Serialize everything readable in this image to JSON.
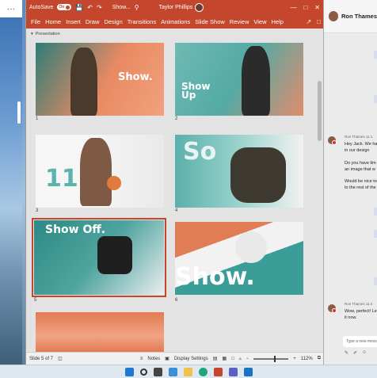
{
  "left_window": {
    "menu_icon": "ellipsis-icon",
    "menu_label": "···"
  },
  "powerpoint": {
    "autosave_label": "AutoSave",
    "autosave_state": "On",
    "doc_title": "Show...",
    "user_name": "Taylor Phillips",
    "tabs": [
      "File",
      "Home",
      "Insert",
      "Draw",
      "Design",
      "Transitions",
      "Animations",
      "Slide Show",
      "Review",
      "View",
      "Help"
    ],
    "section_label": "Presentation",
    "slides": [
      {
        "num": "1",
        "text": "Show."
      },
      {
        "num": "2",
        "text": "Show Up"
      },
      {
        "num": "3",
        "text": "11"
      },
      {
        "num": "4",
        "text": "So"
      },
      {
        "num": "5",
        "text": "Show Off."
      },
      {
        "num": "6",
        "text": "Show."
      },
      {
        "num": "7",
        "text": ""
      }
    ],
    "selected_slide": "5",
    "status": {
      "slide_info": "Slide 5 of 7",
      "notes_label": "Notes",
      "display_settings_label": "Display Settings",
      "zoom": "112%"
    },
    "accent_color": "#c4462c"
  },
  "teams": {
    "contact_name": "Ron Thames",
    "messages": [
      {
        "meta": "Ron Thames 11:1",
        "lines": [
          "Hey Jack. We ha",
          "in our design"
        ]
      },
      {
        "meta": "",
        "lines": [
          "Do you have tim",
          "an image that w"
        ]
      },
      {
        "meta": "",
        "lines": [
          "Would be nice to",
          "to the rest of the"
        ]
      },
      {
        "meta": "Ron Thames 11:4",
        "lines": [
          "Wow, perfect! Le",
          "it now."
        ]
      }
    ],
    "compose_placeholder": "Type a new mess"
  },
  "taskbar": {
    "icons": [
      "windows-start-icon",
      "search-icon",
      "task-view-icon",
      "widgets-icon",
      "file-explorer-icon",
      "edge-icon",
      "powerpoint-icon",
      "teams-icon",
      "mail-icon"
    ]
  }
}
